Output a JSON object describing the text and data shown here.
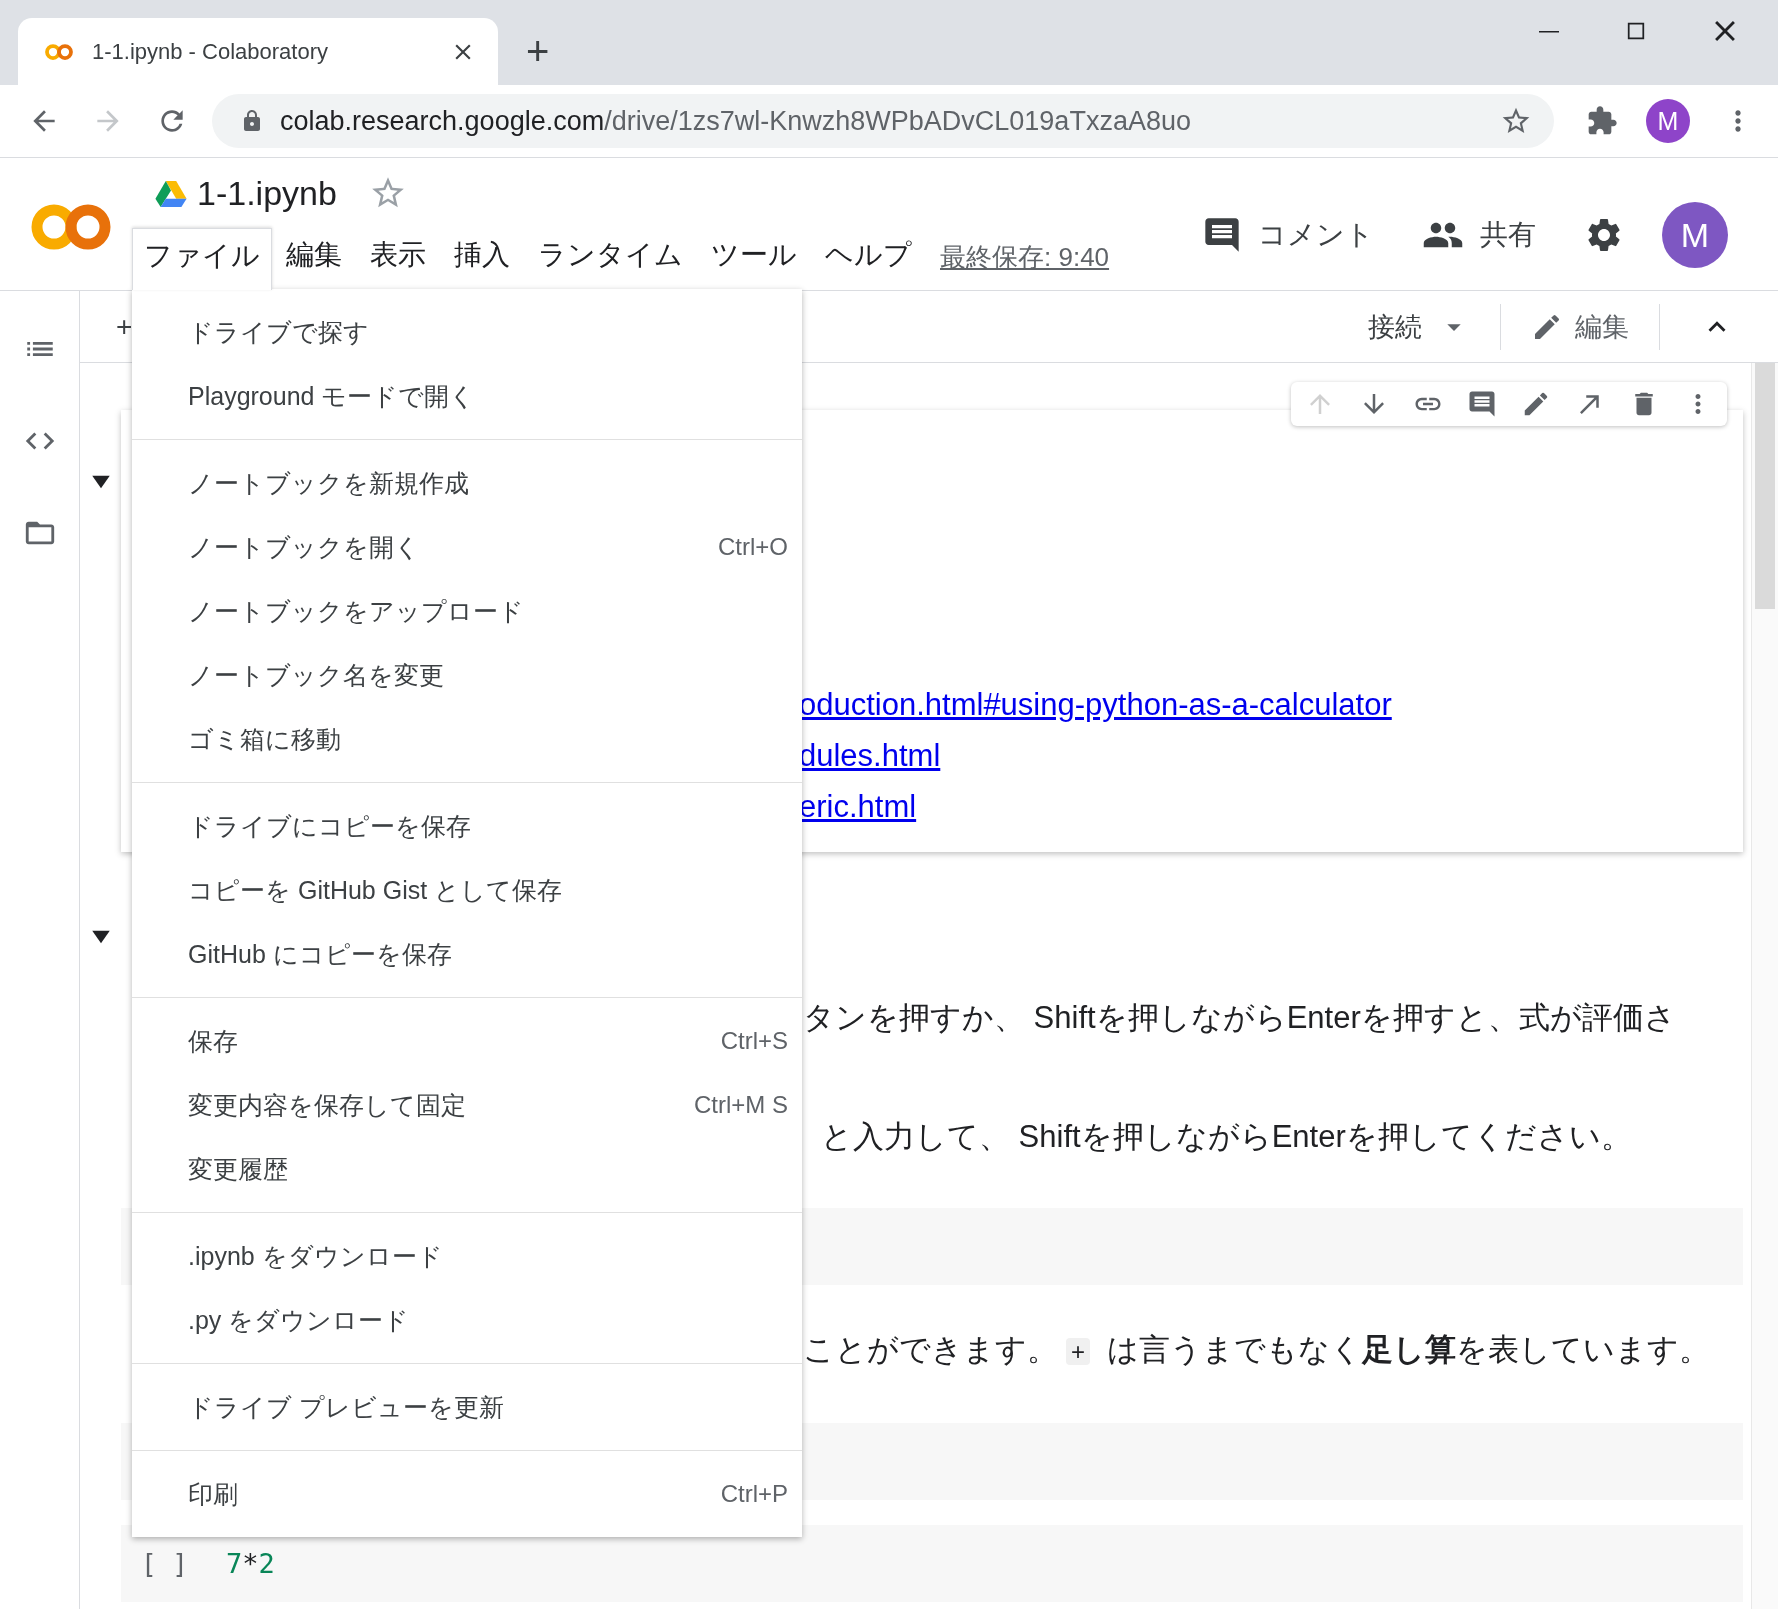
{
  "browser": {
    "tab": {
      "title": "1-1.ipynb - Colaboratory"
    },
    "new_tab": "+",
    "url": {
      "host": "colab.research.google.com",
      "path": "/drive/1zs7wl-Knwzh8WPbADvCL019aTxzaA8uo"
    },
    "forward_disabled": true,
    "profile_initial": "M"
  },
  "notebook": {
    "title": "1-1.ipynb",
    "starred": false,
    "menus": [
      {
        "label": "ファイル",
        "selected": true
      },
      {
        "label": "編集",
        "selected": false
      },
      {
        "label": "表示",
        "selected": false
      },
      {
        "label": "挿入",
        "selected": false
      },
      {
        "label": "ランタイム",
        "selected": false
      },
      {
        "label": "ツール",
        "selected": false
      },
      {
        "label": "ヘルプ",
        "selected": false
      }
    ],
    "last_saved": "最終保存: 9:40",
    "comment": "コメント",
    "share": "共有",
    "avatar": "M"
  },
  "toolbar": {
    "add": "+",
    "connect": "接続",
    "edit": "編集"
  },
  "file_menu": {
    "sections": [
      [
        {
          "label": "ドライブで探す"
        },
        {
          "label": "Playground モードで開く"
        }
      ],
      [
        {
          "label": "ノートブックを新規作成"
        },
        {
          "label": "ノートブックを開く",
          "shortcut": "Ctrl+O"
        },
        {
          "label": "ノートブックをアップロード"
        },
        {
          "label": "ノートブック名を変更"
        },
        {
          "label": "ゴミ箱に移動"
        }
      ],
      [
        {
          "label": "ドライブにコピーを保存"
        },
        {
          "label": "コピーを GitHub Gist として保存"
        },
        {
          "label": "GitHub にコピーを保存"
        }
      ],
      [
        {
          "label": "保存",
          "shortcut": "Ctrl+S"
        },
        {
          "label": "変更内容を保存して固定",
          "shortcut": "Ctrl+M S"
        },
        {
          "label": "変更履歴"
        }
      ],
      [
        {
          "label": ".ipynb をダウンロード"
        },
        {
          "label": ".py をダウンロード"
        }
      ],
      [
        {
          "label": "ドライブ プレビューを更新"
        }
      ],
      [
        {
          "label": "印刷",
          "shortcut": "Ctrl+P"
        }
      ]
    ]
  },
  "cells": [
    {
      "kind": "text",
      "expanded": true,
      "selected": true,
      "cell_toolbar": [
        {
          "kind": "move-up",
          "disabled": true
        },
        {
          "kind": "move-down",
          "disabled": false
        },
        {
          "kind": "link",
          "disabled": false
        },
        {
          "kind": "comment",
          "disabled": false
        },
        {
          "kind": "edit",
          "disabled": false
        },
        {
          "kind": "open",
          "disabled": false
        },
        {
          "kind": "delete",
          "disabled": false
        },
        {
          "kind": "more",
          "disabled": false
        }
      ],
      "links": [
        "oduction.html#using-python-as-a-calculator",
        "dules.html",
        "eric.html"
      ]
    },
    {
      "kind": "section",
      "expanded": true
    },
    {
      "kind": "paragraph",
      "text": "タンを押すか、 Shiftを押しながらEnterを押すと、式が評価さ"
    },
    {
      "kind": "paragraph",
      "text": "と入力して、 Shiftを押しながらEnterを押してください。"
    },
    {
      "kind": "code"
    },
    {
      "kind": "paragraph",
      "text": "ことができます。",
      "code": "+",
      "after": " は言うまでもなく**足し算**を表しています。"
    },
    {
      "kind": "code"
    },
    {
      "kind": "code",
      "prompt": "[ ]",
      "source": "7*2"
    }
  ]
}
